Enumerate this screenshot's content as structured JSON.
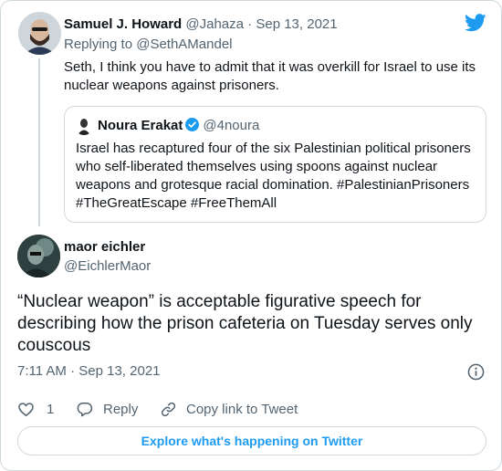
{
  "reply_tweet": {
    "author_name": "Samuel J. Howard",
    "author_handle": "@Jahaza",
    "separator": "·",
    "date": "Sep 13, 2021",
    "replying_prefix": "Replying to",
    "replying_to": "@SethAMandel",
    "text": "Seth, I think you have to admit that it was overkill for Israel to use its nuclear weapons against prisoners."
  },
  "quoted_tweet": {
    "author_name": "Noura Erakat",
    "author_handle": "@4noura",
    "verified": true,
    "text": "Israel has recaptured four of the six Palestinian political prisoners who self-liberated themselves using spoons against nuclear weapons and grotesque racial domination. #PalestinianPrisoners #TheGreatEscape #FreeThemAll"
  },
  "main_tweet": {
    "author_name": "maor eichler",
    "author_handle": "@EichlerMaor",
    "text": "“Nuclear weapon” is acceptable figurative speech for describing how the prison cafeteria on Tuesday serves only couscous",
    "time": "7:11 AM",
    "separator": "·",
    "date": "Sep 13, 2021"
  },
  "actions": {
    "like_count": "1",
    "reply_label": "Reply",
    "copy_label": "Copy link to Tweet"
  },
  "explore_label": "Explore what's happening on Twitter",
  "colors": {
    "twitter_blue": "#1d9bf0",
    "muted_text": "#536471",
    "border": "#cfd9de",
    "text": "#0f1419"
  },
  "icons": [
    "twitter-logo-icon",
    "verified-badge-icon",
    "info-icon",
    "heart-icon",
    "reply-icon",
    "link-icon"
  ]
}
